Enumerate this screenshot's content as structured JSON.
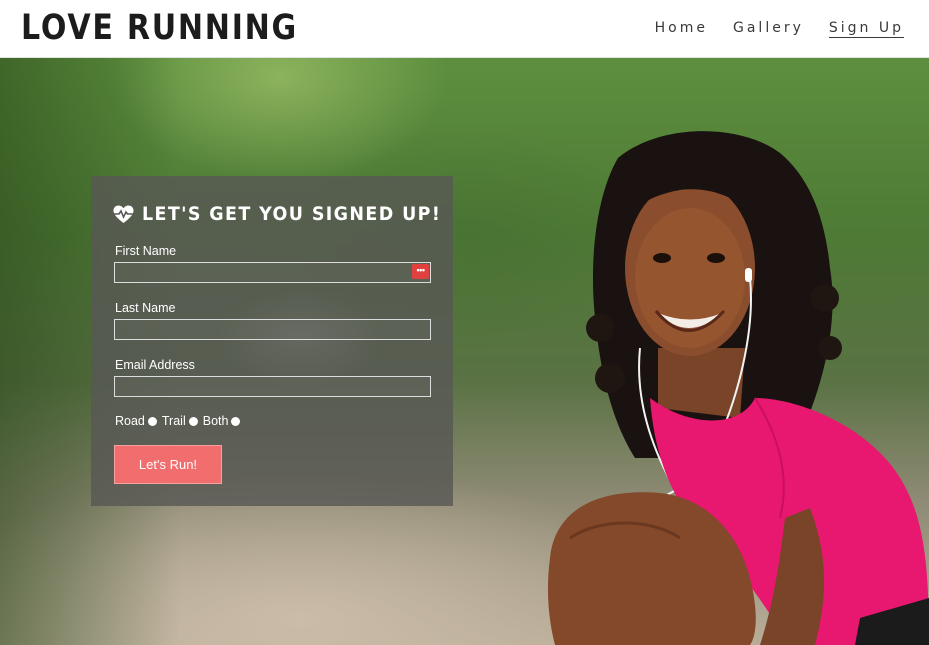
{
  "header": {
    "logo": "LOVE RUNNING",
    "nav": [
      {
        "label": "Home"
      },
      {
        "label": "Gallery"
      },
      {
        "label": "Sign Up"
      }
    ]
  },
  "signup": {
    "title": "LET'S GET YOU SIGNED UP!",
    "title_icon": "heartbeat-icon",
    "fields": {
      "first_name": {
        "label": "First Name",
        "value": "",
        "badge": "•••"
      },
      "last_name": {
        "label": "Last Name",
        "value": ""
      },
      "email": {
        "label": "Email Address",
        "value": ""
      }
    },
    "run_types": [
      {
        "label": "Road"
      },
      {
        "label": "Trail"
      },
      {
        "label": "Both"
      }
    ],
    "submit_label": "Let's Run!"
  },
  "colors": {
    "button": "#f26d6d",
    "panel": "#585854",
    "shirt": "#e8176f",
    "badge": "#e0403e"
  }
}
